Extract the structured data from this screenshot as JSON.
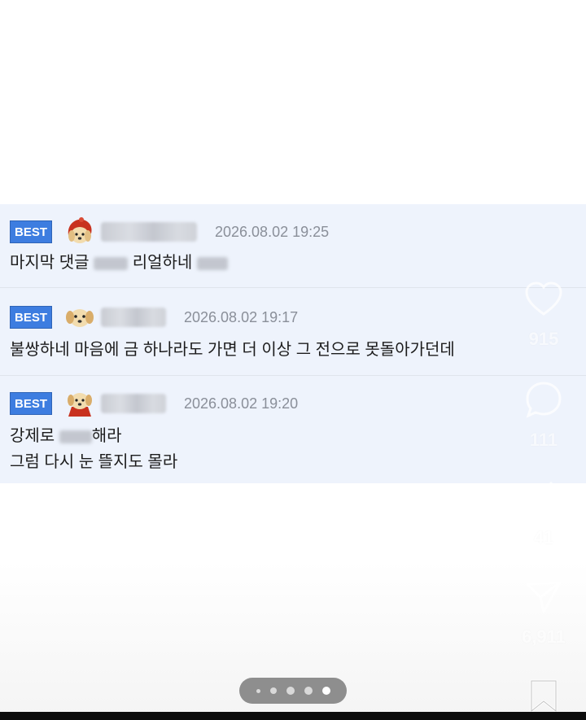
{
  "comments": [
    {
      "badge": "BEST",
      "date": "2026.08.02 19:25",
      "lines": [
        "마지막 댓글",
        "리얼하네"
      ]
    },
    {
      "badge": "BEST",
      "date": "2026.08.02 19:17",
      "lines": [
        "불쌍하네 마음에 금 하나라도 가면 더 이상 그 전으로 못돌아가던데"
      ]
    },
    {
      "badge": "BEST",
      "date": "2026.08.02 19:20",
      "lines": [
        "강제로",
        "해라",
        "그럼 다시 눈 뜰지도 몰라"
      ]
    }
  ],
  "rail": {
    "like_count": "915",
    "comment_count": "111",
    "repost_count": "41",
    "share_count": "6,911",
    "icons": [
      "heart-icon",
      "comment-bubble-icon",
      "repost-icon",
      "send-icon",
      "bookmark-icon"
    ]
  },
  "pager": {
    "total": 5,
    "active_index": 4
  },
  "colors": {
    "best_badge": "#3d7de0",
    "comment_bg": "#eef3fc",
    "date_text": "#8a8f99"
  }
}
